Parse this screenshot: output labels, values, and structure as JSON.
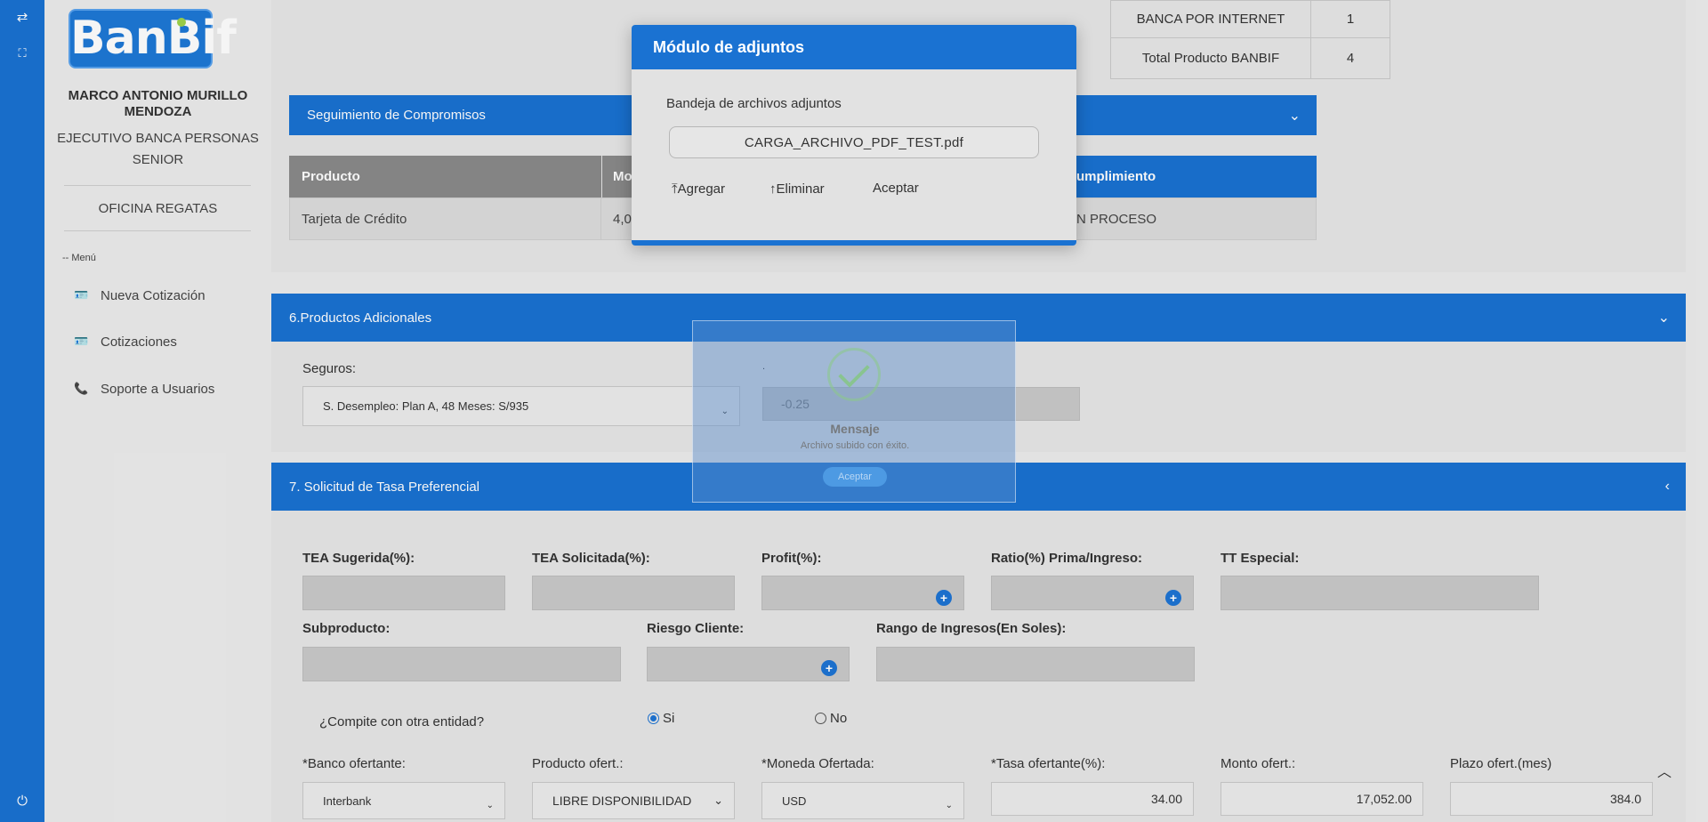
{
  "sidebar": {
    "logo": "BanBif",
    "user_name": "MARCO ANTONIO MURILLO MENDOZA",
    "user_role": "EJECUTIVO BANCA PERSONAS SENIOR",
    "office": "OFICINA REGATAS",
    "menu_label": "-- Menú",
    "items": [
      {
        "label": "Nueva Cotización",
        "icon": "id-card-icon"
      },
      {
        "label": "Cotizaciones",
        "icon": "id-card-icon"
      },
      {
        "label": "Soporte a Usuarios",
        "icon": "phone-icon"
      }
    ]
  },
  "summary_table": {
    "rows": [
      {
        "label": "BANCA POR INTERNET",
        "value": "1"
      },
      {
        "label": "Total Producto BANBIF",
        "value": "4"
      }
    ]
  },
  "seguimiento": {
    "title": "Seguimiento de Compromisos",
    "headers": [
      "Producto",
      "Mo",
      "umplimiento"
    ],
    "row": [
      "Tarjeta de Crédito",
      "4,0",
      "N PROCESO"
    ]
  },
  "productos": {
    "title": "6.Productos Adicionales",
    "seguros_label": "Seguros:",
    "seguros_value": "S. Desempleo: Plan A, 48 Meses: S/935",
    "dot_label": ".",
    "amount": "-0.25"
  },
  "tasa": {
    "title": "7. Solicitud de Tasa Preferencial",
    "fields_row1": [
      "TEA Sugerida(%):",
      "TEA Solicitada(%):",
      "Profit(%):",
      "Ratio(%) Prima/Ingreso:",
      "TT Especial:"
    ],
    "fields_row2": [
      "Subproducto:",
      "Riesgo Cliente:",
      "Rango de Ingresos(En Soles):"
    ],
    "compite_label": "¿Compite con otra entidad?",
    "si": "Si",
    "no": "No",
    "row3_labels": [
      "*Banco ofertante:",
      "Producto ofert.:",
      "*Moneda Ofertada:",
      "*Tasa ofertante(%):",
      "Monto ofert.:",
      "Plazo ofert.(mes)"
    ],
    "banco": "Interbank",
    "producto": "LIBRE DISPONIBILIDAD",
    "moneda": "USD",
    "tasa_val": "34.00",
    "monto": "17,052.00",
    "plazo": "384.0"
  },
  "modal": {
    "title": "Módulo de adjuntos",
    "subtitle": "Bandeja de archivos adjuntos",
    "file": "CARGA_ARCHIVO_PDF_TEST.pdf",
    "add": "Agregar",
    "delete": "Eliminar",
    "accept": "Aceptar"
  },
  "toast": {
    "title": "Mensaje",
    "message": "Archivo subido con éxito.",
    "button": "Aceptar"
  },
  "colors": {
    "primary": "#1a72d2",
    "table_header": "#8a8a8a",
    "background": "#ececec"
  }
}
